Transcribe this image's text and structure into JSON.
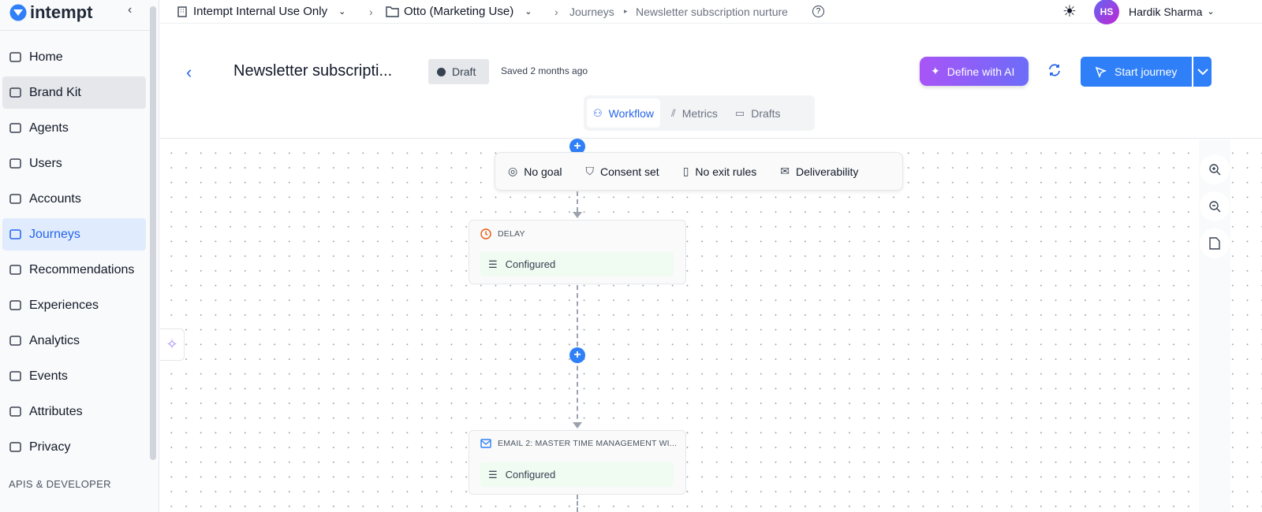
{
  "sidebar": {
    "brand": "intempt",
    "items": [
      {
        "label": "Home",
        "icon": "home-icon"
      },
      {
        "label": "Brand Kit",
        "icon": "store-icon"
      },
      {
        "label": "Agents",
        "icon": "bot-icon"
      },
      {
        "label": "Users",
        "icon": "users-icon"
      },
      {
        "label": "Accounts",
        "icon": "building-icon"
      },
      {
        "label": "Journeys",
        "icon": "route-icon"
      },
      {
        "label": "Recommendations",
        "icon": "bag-icon"
      },
      {
        "label": "Experiences",
        "icon": "shuffle-icon"
      },
      {
        "label": "Analytics",
        "icon": "bar-chart-icon"
      },
      {
        "label": "Events",
        "icon": "activity-icon"
      },
      {
        "label": "Attributes",
        "icon": "table-icon"
      },
      {
        "label": "Privacy",
        "icon": "mask-icon"
      }
    ],
    "section": "APIS & DEVELOPER"
  },
  "topbar": {
    "org": "Intempt Internal Use Only",
    "project": "Otto (Marketing Use)",
    "crumb1": "Journeys",
    "crumb2": "Newsletter subscription nurture",
    "user_initials": "HS",
    "user_name": "Hardik Sharma"
  },
  "header": {
    "title": "Newsletter subscripti...",
    "status": "Draft",
    "saved": "Saved 2 months ago",
    "ai_label": "Define with AI",
    "start_label": "Start journey",
    "tabs": [
      {
        "label": "Workflow"
      },
      {
        "label": "Metrics"
      },
      {
        "label": "Drafts"
      }
    ]
  },
  "canvas": {
    "rules": [
      "No goal",
      "Consent set",
      "No exit rules",
      "Deliverability"
    ],
    "nodes": [
      {
        "type": "DELAY",
        "status": "Configured"
      },
      {
        "type": "EMAIL 2: MASTER TIME MANAGEMENT WI...",
        "status": "Configured"
      }
    ]
  },
  "colors": {
    "accent": "#2e7ff8",
    "active_bg": "#e0ecfd",
    "ai_from": "#a855f7",
    "ai_to": "#6d6cf8",
    "delay": "#ea580c"
  }
}
